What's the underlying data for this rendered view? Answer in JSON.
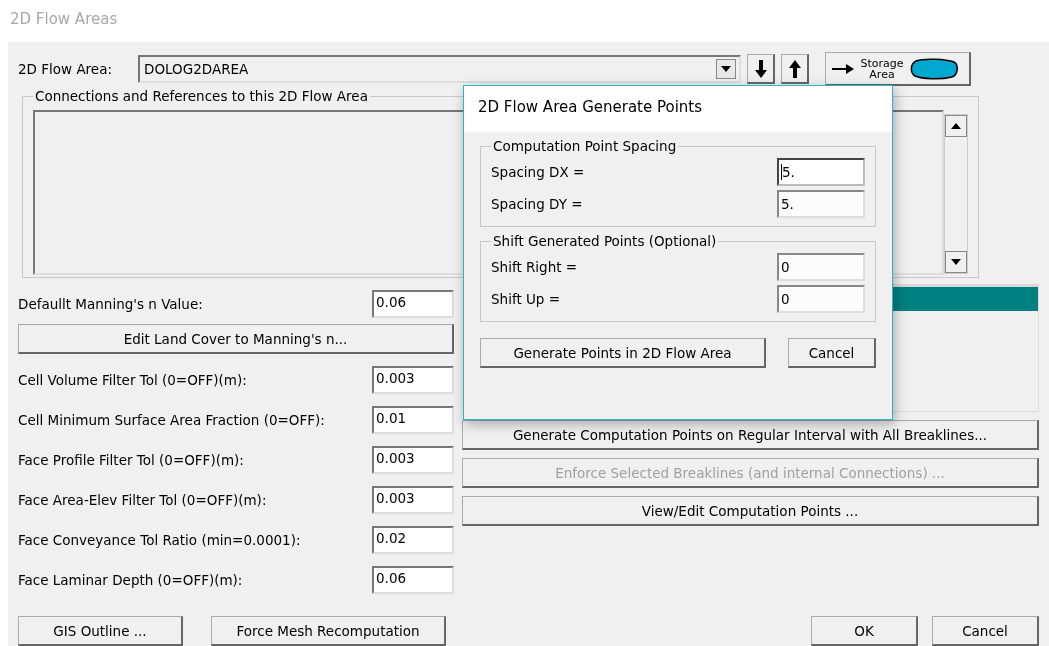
{
  "window": {
    "title": "2D Flow Areas"
  },
  "flow_area": {
    "label": "2D Flow Area:",
    "value": "DOLOG2DAREA",
    "storage_button": "Storage Area"
  },
  "connections": {
    "title": "Connections and References to this 2D Flow Area"
  },
  "manning": {
    "label": "Defaullt Manning's n Value:",
    "value": "0.06",
    "button": "Edit Land Cover to Manning's n..."
  },
  "tolerances": [
    {
      "label": "Cell Volume Filter Tol (0=OFF)(m):",
      "value": "0.003"
    },
    {
      "label": "Cell Minimum Surface Area Fraction (0=OFF):",
      "value": "0.01"
    },
    {
      "label": "Face Profile Filter Tol (0=OFF)(m):",
      "value": "0.003"
    },
    {
      "label": "Face Area-Elev Filter Tol (0=OFF)(m):",
      "value": "0.003"
    },
    {
      "label": "Face Conveyance Tol Ratio (min=0.0001):",
      "value": "0.02"
    },
    {
      "label": "Face Laminar Depth (0=OFF)(m):",
      "value": "0.06"
    }
  ],
  "right_buttons": [
    {
      "label": "Generate Computation Points on Regular Interval with All Breaklines...",
      "disabled": false
    },
    {
      "label": "Enforce Selected Breaklines (and internal Connections) ...",
      "disabled": true
    },
    {
      "label": "View/Edit Computation Points ...",
      "disabled": false
    }
  ],
  "bottom_left_buttons": [
    "GIS Outline ...",
    "Force Mesh Recomputation"
  ],
  "bottom_right_buttons": [
    "OK",
    "Cancel"
  ],
  "dialog": {
    "title": "2D Flow Area Generate Points",
    "groups": [
      {
        "title": "Computation Point Spacing",
        "fields": [
          {
            "label": "Spacing DX =",
            "value": "5.",
            "focused": true
          },
          {
            "label": "Spacing DY =",
            "value": "5.",
            "focused": false
          }
        ]
      },
      {
        "title": "Shift Generated Points (Optional)",
        "fields": [
          {
            "label": "Shift Right =",
            "value": "0",
            "focused": false
          },
          {
            "label": "Shift Up =",
            "value": "0",
            "focused": false
          }
        ]
      }
    ],
    "buttons": [
      "Generate Points in 2D Flow Area",
      "Cancel"
    ]
  }
}
